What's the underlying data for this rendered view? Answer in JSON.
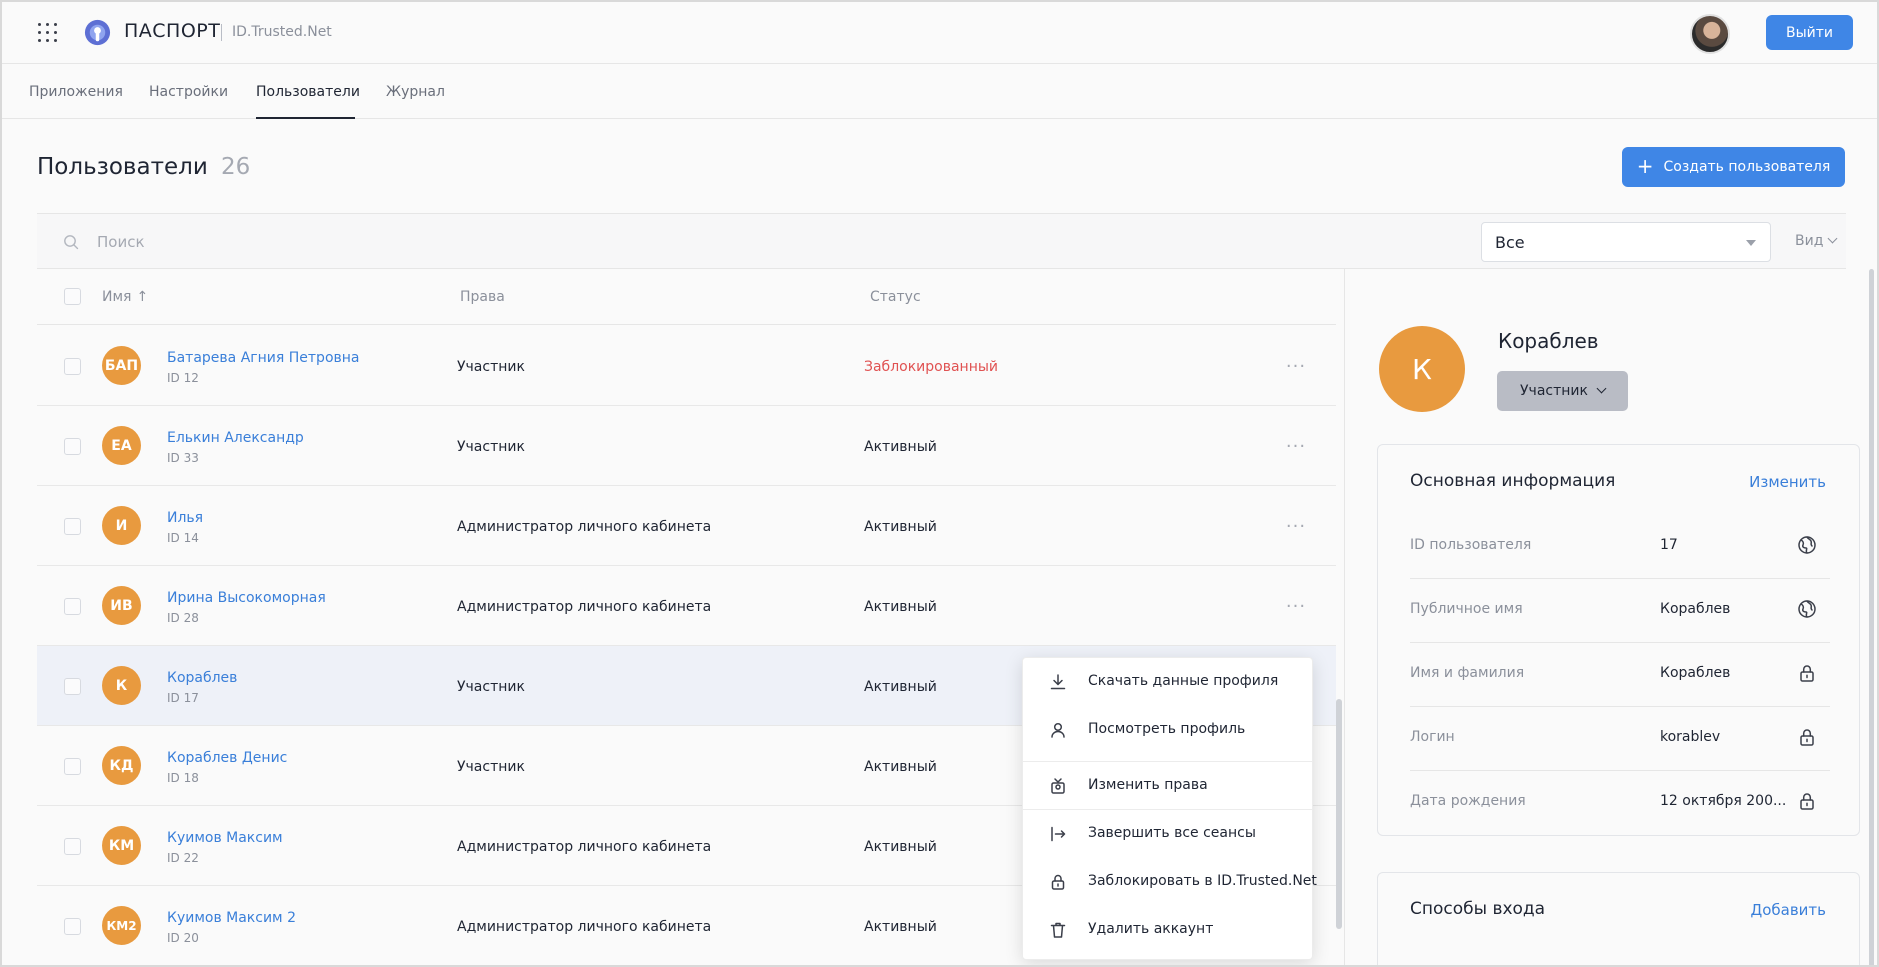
{
  "header": {
    "brand": "ПАСПОРТ",
    "brand_sub": "ID.Trusted.Net",
    "logout_label": "Выйти"
  },
  "tabs": [
    {
      "label": "Приложения"
    },
    {
      "label": "Настройки"
    },
    {
      "label": "Пользователи",
      "active": true
    },
    {
      "label": "Журнал"
    }
  ],
  "page": {
    "title": "Пользователи",
    "count": "26",
    "create_label": "Создать пользователя"
  },
  "filters": {
    "search_placeholder": "Поиск",
    "status_select": "Все",
    "view_label": "Вид"
  },
  "table": {
    "columns": {
      "name": "Имя",
      "rights": "Права",
      "status": "Статус"
    },
    "sort_indicator": "↑",
    "rows": [
      {
        "initials": "БАП",
        "name": "Батарева Агния Петровна",
        "id": "ID 12",
        "role": "Участник",
        "status": "Заблокированный",
        "blocked": true
      },
      {
        "initials": "ЕА",
        "name": "Елькин Александр",
        "id": "ID 33",
        "role": "Участник",
        "status": "Активный"
      },
      {
        "initials": "И",
        "name": "Илья",
        "id": "ID 14",
        "role": "Администратор личного кабинета",
        "status": "Активный"
      },
      {
        "initials": "ИВ",
        "name": "Ирина Высокоморная",
        "id": "ID 28",
        "role": "Администратор личного кабинета",
        "status": "Активный"
      },
      {
        "initials": "К",
        "name": "Кораблев",
        "id": "ID 17",
        "role": "Участник",
        "status": "Активный",
        "selected": true
      },
      {
        "initials": "КД",
        "name": "Кораблев Денис",
        "id": "ID 18",
        "role": "Участник",
        "status": "Активный"
      },
      {
        "initials": "КМ",
        "name": "Куимов Максим",
        "id": "ID 22",
        "role": "Администратор личного кабинета",
        "status": "Активный"
      },
      {
        "initials": "КМ2",
        "name": "Куимов Максим 2",
        "id": "ID 20",
        "role": "Администратор личного кабинета",
        "status": "Активный"
      }
    ],
    "more_glyph": "···"
  },
  "context_menu": {
    "items": [
      {
        "icon": "download-icon",
        "label": "Скачать данные профиля"
      },
      {
        "icon": "user-icon",
        "label": "Посмотреть профиль"
      },
      {
        "icon": "user-badge-icon",
        "label": "Изменить права"
      },
      {
        "icon": "logout-arrow-icon",
        "label": "Завершить все сеансы"
      },
      {
        "icon": "lock-icon",
        "label": "Заблокировать в ID.Trusted.Net"
      },
      {
        "icon": "trash-icon",
        "label": "Удалить аккаунт"
      }
    ]
  },
  "profile": {
    "initial": "К",
    "name": "Кораблев",
    "role_label": "Участник",
    "main_info": {
      "title": "Основная информация",
      "action": "Изменить",
      "fields": [
        {
          "label": "ID пользователя",
          "value": "17",
          "icon": "globe-icon"
        },
        {
          "label": "Публичное имя",
          "value": "Кораблев",
          "icon": "globe-icon"
        },
        {
          "label": "Имя и фамилия",
          "value": "Кораблев",
          "icon": "lock-icon"
        },
        {
          "label": "Логин",
          "value": "korablev",
          "icon": "lock-icon"
        },
        {
          "label": "Дата рождения",
          "value": "12 октября 200...",
          "icon": "lock-icon"
        }
      ]
    },
    "login_methods": {
      "title": "Способы входа",
      "action": "Добавить"
    }
  },
  "colors": {
    "accent": "#3f86e6",
    "link": "#3a7fd9",
    "avatar": "#e89a3f",
    "blocked": "#e05252"
  }
}
